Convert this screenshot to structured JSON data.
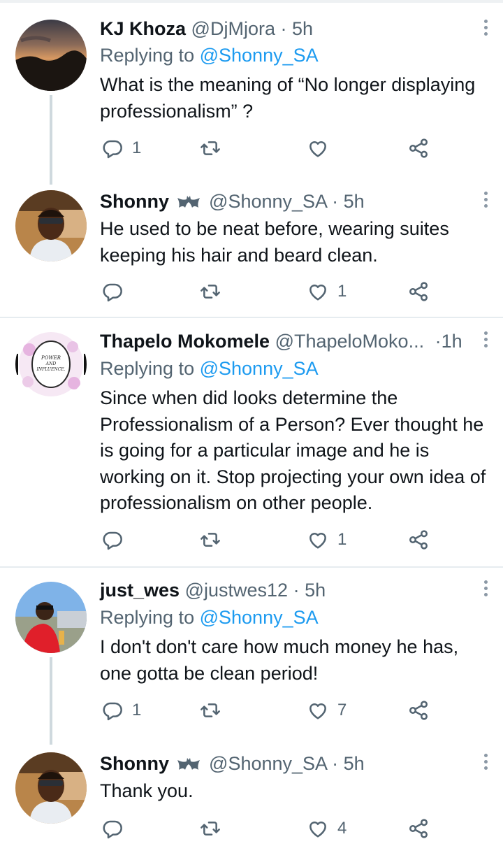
{
  "tweets": [
    {
      "name": "KJ Khoza",
      "handle": "@DjMjora",
      "time": "5h",
      "badge": false,
      "replying_label": "Replying to",
      "replying_to": "@Shonny_SA",
      "text": "What is the meaning of “No longer displaying professionalism” ?",
      "reply_count": "1",
      "retweet_count": "",
      "like_count": ""
    },
    {
      "name": "Shonny",
      "handle": "@Shonny_SA",
      "time": "5h",
      "badge": true,
      "replying_label": "",
      "replying_to": "",
      "text": "He used to be neat before, wearing suites keeping his hair and beard clean.",
      "reply_count": "",
      "retweet_count": "",
      "like_count": "1"
    },
    {
      "name": "Thapelo Mokomele",
      "handle": "@ThapeloMoko...",
      "time": "1h",
      "badge": false,
      "avatar_text": [
        "POWER",
        "AND",
        "INFLUENCE."
      ],
      "replying_label": "Replying to",
      "replying_to": "@Shonny_SA",
      "text": "Since when did looks determine the Professionalism of a Person? Ever thought he is going for a particular image and he is working on it. Stop projecting your own idea of professionalism on other people.",
      "reply_count": "",
      "retweet_count": "",
      "like_count": "1"
    },
    {
      "name": "just_wes",
      "handle": "@justwes12",
      "time": "5h",
      "badge": false,
      "replying_label": "Replying to",
      "replying_to": "@Shonny_SA",
      "text": "I don't don't care how much money he has, one gotta be clean period!",
      "reply_count": "1",
      "retweet_count": "",
      "like_count": "7"
    },
    {
      "name": "Shonny",
      "handle": "@Shonny_SA",
      "time": "5h",
      "badge": true,
      "replying_label": "",
      "replying_to": "",
      "text": "Thank you.",
      "reply_count": "",
      "retweet_count": "",
      "like_count": "4"
    }
  ],
  "separator_dot": "·",
  "colors": {
    "link": "#1d9bf0",
    "muted": "#536471",
    "text": "#0f1419",
    "thread_line": "#cfd9de"
  },
  "icons": [
    "reply-icon",
    "retweet-icon",
    "like-icon",
    "share-icon",
    "more-icon",
    "bat-badge-icon"
  ]
}
